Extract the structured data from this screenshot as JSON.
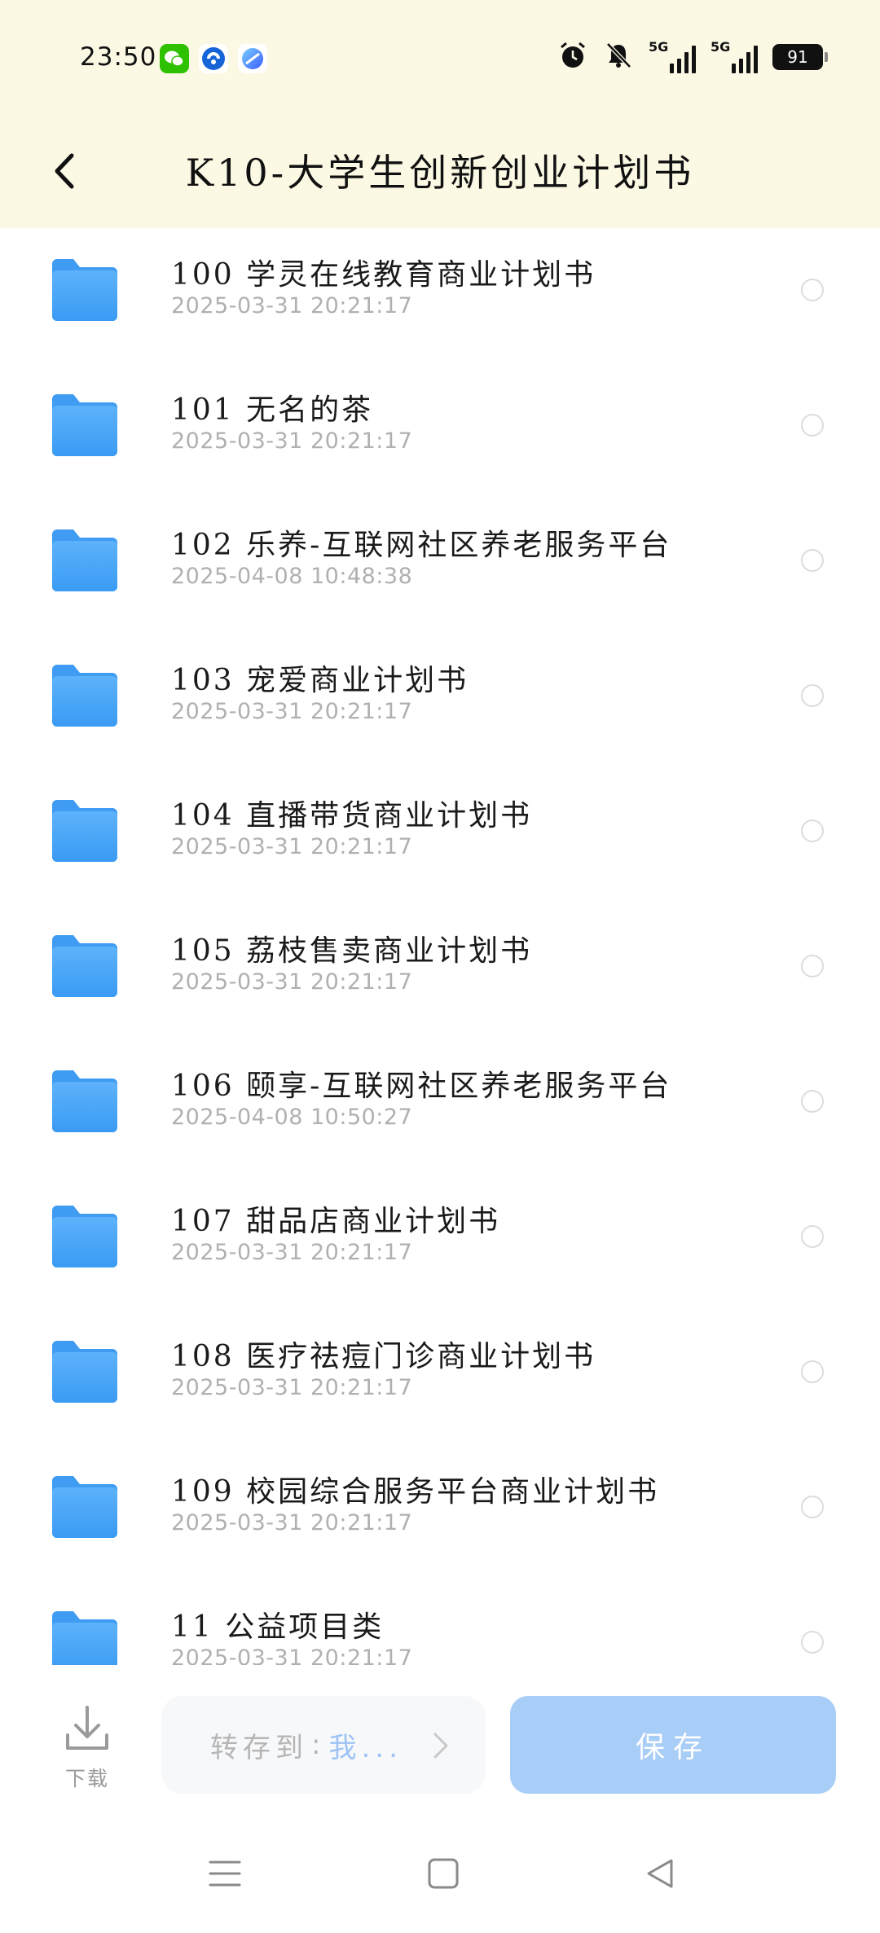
{
  "status_bar": {
    "time": "23:50",
    "battery": "91",
    "signal1_label": "5G",
    "signal2_label": "5G",
    "apps": [
      "wechat-icon",
      "app-blue-icon",
      "app-gradient-icon"
    ]
  },
  "header": {
    "title": "K10-大学生创新创业计划书"
  },
  "files": [
    {
      "name": "100 学灵在线教育商业计划书",
      "date": "2025-03-31  20:21:17"
    },
    {
      "name": "101 无名的茶",
      "date": "2025-03-31  20:21:17"
    },
    {
      "name": "102 乐养-互联网社区养老服务平台",
      "date": "2025-04-08  10:48:38"
    },
    {
      "name": "103 宠爱商业计划书",
      "date": "2025-03-31  20:21:17"
    },
    {
      "name": "104 直播带货商业计划书",
      "date": "2025-03-31  20:21:17"
    },
    {
      "name": "105 荔枝售卖商业计划书",
      "date": "2025-03-31  20:21:17"
    },
    {
      "name": "106 颐享-互联网社区养老服务平台",
      "date": "2025-04-08  10:50:27"
    },
    {
      "name": "107 甜品店商业计划书",
      "date": "2025-03-31  20:21:17"
    },
    {
      "name": "108 医疗祛痘门诊商业计划书",
      "date": "2025-03-31  20:21:17"
    },
    {
      "name": "109 校园综合服务平台商业计划书",
      "date": "2025-03-31  20:21:17"
    },
    {
      "name": "11 公益项目类",
      "date": "2025-03-31  20:21:17"
    }
  ],
  "action_bar": {
    "download_label": "下载",
    "saveto_label": "转存到",
    "saveto_sep": ":",
    "saveto_target": "我...",
    "save_label": "保存"
  },
  "colors": {
    "header_bg": "#fbf8e4",
    "folder_blue": "#4aa6f8",
    "save_button": "#a8cdf7",
    "target_text": "#9dc3f5"
  }
}
